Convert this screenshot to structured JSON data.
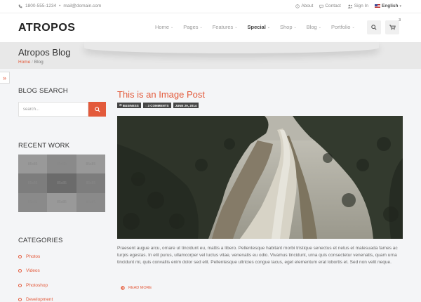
{
  "topbar": {
    "phone": "1800-555-1234",
    "separator": "•",
    "email": "mail@domain.com",
    "about": "About",
    "contact": "Contact",
    "sign_in": "Sign In",
    "language": "English"
  },
  "header": {
    "logo": "ATROPOS",
    "nav": [
      {
        "label": "Home",
        "bold": false
      },
      {
        "label": "Pages",
        "bold": false
      },
      {
        "label": "Features",
        "bold": false
      },
      {
        "label": "Special",
        "bold": true
      },
      {
        "label": "Shop",
        "bold": false
      },
      {
        "label": "Blog",
        "bold": false
      },
      {
        "label": "Portfolio",
        "bold": false
      }
    ],
    "cart_count": "3"
  },
  "page": {
    "title": "Atropos Blog",
    "breadcrumb_home": "Home",
    "breadcrumb_current": "Blog"
  },
  "sidebar": {
    "search_title": "BLOG SEARCH",
    "search_placeholder": "search...",
    "recent_work_title": "RECENT WORK",
    "thumbs": [
      "85x85",
      "85x85",
      "85x85",
      "85x85",
      "85x85",
      "85x85",
      "85x85",
      "85x85",
      "85x85"
    ],
    "categories_title": "CATEGORIES",
    "categories": [
      "Photos",
      "Videos",
      "Photoshop",
      "Development"
    ]
  },
  "post": {
    "title": "This is an Image Post",
    "tags": [
      "BUSINESS",
      "3 COMMENTS",
      "JUNE 29, 2014"
    ],
    "excerpt": "Praesent augue arcu, ornare ut tincidunt eu, mattis a libero. Pellentesque habitant morbi tristique senectus et netus et malesuada fames ac turpis egestas. In elit purus, ullamcorper vel luctus vitae, venenatis eu odio. Vivamus tincidunt, urna quis consectetur venenatis, quam urna tincidunt mi, quis convallis enim dolor sed elit. Pellentesque ultricies congue lacus, eget elementum erat lobortis et. Sed non velit neque.",
    "read_more": "READ MORE"
  },
  "colors": {
    "accent": "#e35a3b"
  }
}
